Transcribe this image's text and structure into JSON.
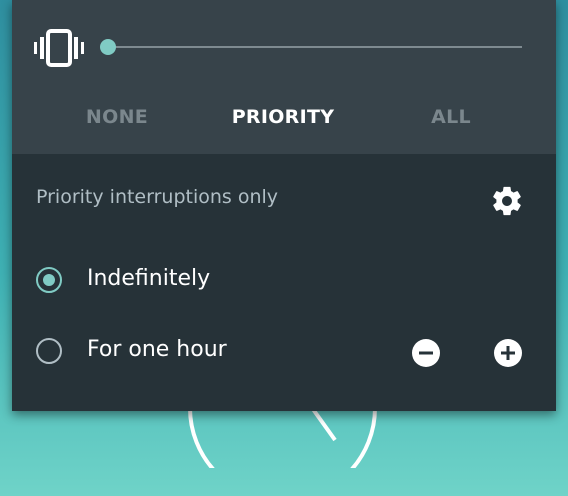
{
  "accent_color": "#80cbc4",
  "volume_row": {
    "icon": "vibrate-icon",
    "level": 0
  },
  "modes": {
    "tabs": [
      {
        "label": "NONE",
        "selected": false
      },
      {
        "label": "PRIORITY",
        "selected": true
      },
      {
        "label": "ALL",
        "selected": false
      }
    ]
  },
  "condition": {
    "label": "Priority interruptions only",
    "settings_icon": "gear-icon"
  },
  "options": [
    {
      "label": "Indefinitely",
      "selected": true
    },
    {
      "label": "For one hour",
      "selected": false
    }
  ],
  "duration_controls": {
    "minus_icon": "minus-circle-icon",
    "plus_icon": "plus-circle-icon"
  }
}
